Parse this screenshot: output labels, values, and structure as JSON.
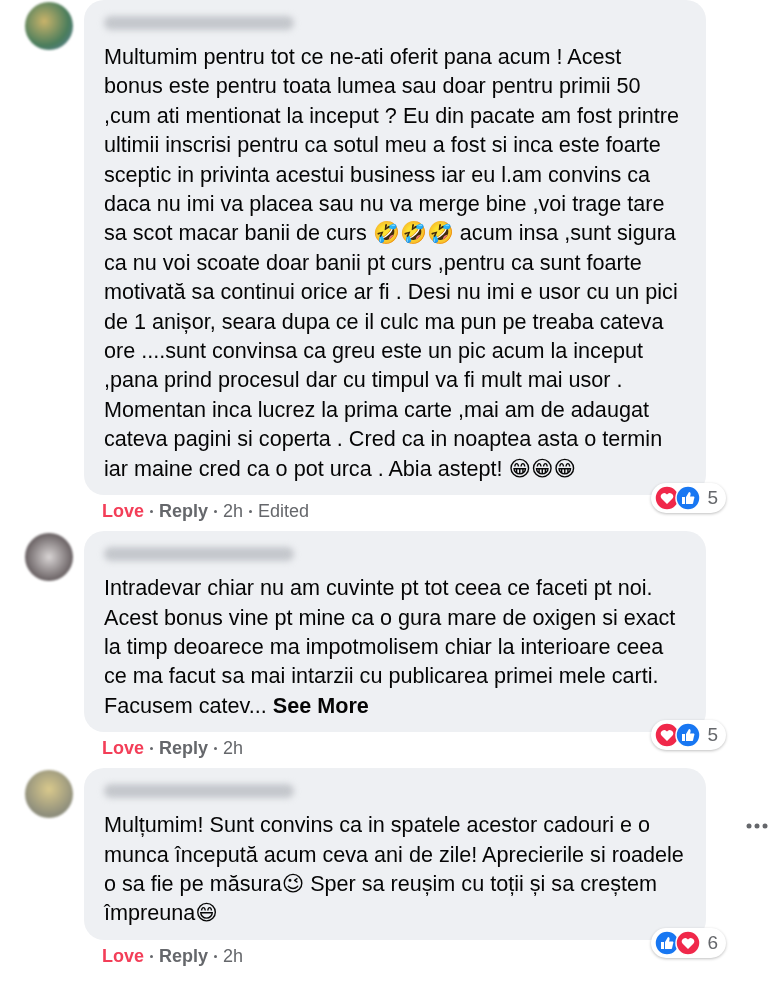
{
  "comments": [
    {
      "text": "Multumim pentru tot ce ne-ati oferit pana acum ! Acest bonus este pentru toata lumea sau doar pentru primii 50 ,cum ati mentionat la inceput ? Eu din pacate am fost printre ultimii inscrisi pentru ca sotul meu a fost si inca este foarte sceptic in privinta acestui business iar eu l.am convins ca daca nu imi va placea sau nu va merge bine ,voi trage tare sa scot macar banii de curs 🤣🤣🤣 acum insa ,sunt sigura ca nu voi scoate doar banii pt curs ,pentru ca sunt foarte motivată sa continui orice ar fi . Desi nu imi e usor cu un pici de 1 anișor, seara dupa ce il culc ma pun pe treaba cateva ore ....sunt convinsa ca greu este un pic acum la inceput ,pana prind procesul dar cu timpul va fi mult mai usor . Momentan inca lucrez la prima carte ,mai am de adaugat cateva pagini si coperta . Cred ca in noaptea asta o termin iar maine cred ca o pot urca . Abia astept! 😁😁😁",
      "actions": [
        "Love",
        "Reply",
        "2h",
        "Edited"
      ],
      "reactions": [
        {
          "kind": "love"
        },
        {
          "kind": "like"
        }
      ],
      "reaction_count": "5"
    },
    {
      "text": "Intradevar chiar nu am cuvinte pt tot ceea ce faceti pt noi. Acest bonus vine pt mine ca o gura mare de oxigen si exact la timp deoarece ma impotmolisem chiar la interioare ceea ce ma facut sa mai intarzii cu publicarea primei mele carti. Facusem catev...",
      "see_more": "See More",
      "actions": [
        "Love",
        "Reply",
        "2h"
      ],
      "reactions": [
        {
          "kind": "love"
        },
        {
          "kind": "like"
        }
      ],
      "reaction_count": "5"
    },
    {
      "text": "Mulțumim! Sunt convins ca in spatele acestor cadouri e o munca începută acum ceva ani de zile! Aprecierile si roadele o sa fie pe măsura😉 Sper sa reușim cu toții și sa creștem împreuna😄",
      "actions": [
        "Love",
        "Reply",
        "2h"
      ],
      "reactions": [
        {
          "kind": "like"
        },
        {
          "kind": "love"
        }
      ],
      "reaction_count": "6",
      "more_menu": true
    }
  ]
}
